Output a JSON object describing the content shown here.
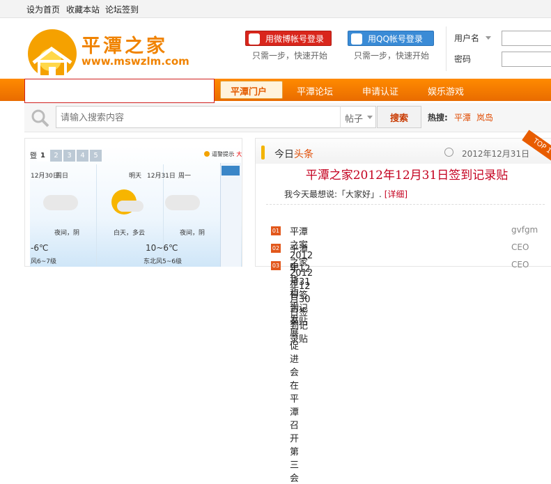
{
  "topbar": {
    "home": "设为首页",
    "fav": "收藏本站",
    "sign": "论坛签到"
  },
  "logo": {
    "title": "平潭之家",
    "url": "www.mswzlm.com"
  },
  "login": {
    "weibo": "用微博帐号登录",
    "qq": "用QQ帐号登录",
    "sub": "只需一步，快速开始",
    "username": "用户名",
    "password": "密码"
  },
  "nav": {
    "items": [
      "平潭门户",
      "平潭论坛",
      "申请认证",
      "娱乐游戏"
    ]
  },
  "search": {
    "placeholder": "请输入搜索内容",
    "select": "帖子",
    "button": "搜索",
    "hot_label": "热搜:",
    "hot": [
      "平潭",
      "岚岛"
    ]
  },
  "weather": {
    "tabs": [
      "1",
      "2",
      "3",
      "4",
      "5"
    ],
    "alert": "逼警提示",
    "day1": {
      "date": "12月30日",
      "dow": "周日",
      "night": "夜间，阴",
      "temp": "-6℃",
      "wind": "风6~7级"
    },
    "day2": {
      "day": "白天，多云",
      "tomorrow": "明天",
      "date": "12月31日",
      "dow": "周一"
    },
    "day3": {
      "night": "夜间，阴",
      "temp": "10~6℃",
      "wind": "东北风5~6级"
    }
  },
  "today": {
    "label": "今日",
    "label2": "头条",
    "date": "2012年12月31日",
    "ribbon": "TOP 1",
    "headline": "平潭之家2012年12月31日签到记录贴",
    "summary": "我今天最想说:「大家好」.",
    "more": "[详细]"
  },
  "list": [
    {
      "num": "01",
      "title": "平潭之家2012年12月31日签到记录贴",
      "author": "gvfgm"
    },
    {
      "num": "02",
      "title": "平潭之家2012年12月30日签到记录贴",
      "author": "CEO"
    },
    {
      "num": "03",
      "title": "中华和平发展促进会在平潭召开第三会",
      "author": "CEO"
    }
  ],
  "colors": {
    "brand": "#f08300",
    "nav": "#ff8a00",
    "headline": "#c4001f"
  }
}
